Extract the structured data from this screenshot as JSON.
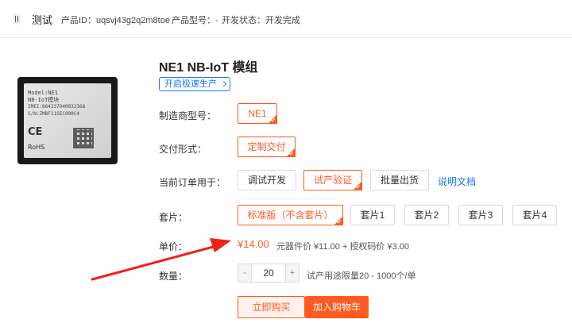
{
  "header": {
    "title": "测试",
    "product_id": "产品ID：uqsvj43g2q2m8toe",
    "product_model": "产品型号：-",
    "dev_status": "开发状态：开发完成"
  },
  "product": {
    "name": "NE1 NB-IoT 模组",
    "fast_production_label": "开启极速生产",
    "image_text": {
      "model": "Model:NE1",
      "type": "NB-IoT模块",
      "imei": "IMEI:864237040032368",
      "sn": "S/N:ZMBF11SEC000C4",
      "ce": "CE",
      "rohs": "RoHS"
    }
  },
  "form": {
    "manufacturer_model_label": "制造商型号：",
    "manufacturer_models": [
      "NE1"
    ],
    "delivery_label": "交付形式：",
    "delivery_options": [
      "定制交付"
    ],
    "order_use_label": "当前订单用于：",
    "order_use_options": [
      "调试开发",
      "试产验证",
      "批量出货"
    ],
    "doc_link": "说明文档",
    "kit_label": "套片：",
    "kit_options": [
      "标准版（不含套片）",
      "套片1",
      "套片2",
      "套片3",
      "套片4"
    ],
    "unit_price_label": "单价：",
    "price": "¥14.00",
    "price_detail": "元器件价 ¥11.00 + 授权码价 ¥3.00",
    "quantity_label": "数量：",
    "quantity_minus": "-",
    "quantity_value": "20",
    "quantity_plus": "+",
    "quantity_note": "试产用途限量20 - 1000个/单"
  },
  "actions": {
    "buy_now": "立即购买",
    "add_to_cart": "加入购物车"
  },
  "colors": {
    "accent": "#ff5a1f",
    "link": "#1677ff",
    "annotation_arrow": "#f0201a"
  }
}
